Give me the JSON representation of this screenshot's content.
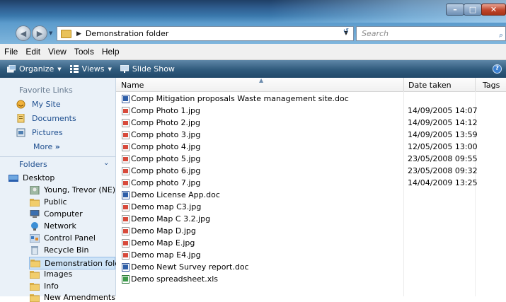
{
  "address": {
    "path": "Demonstration folder"
  },
  "search": {
    "placeholder": "Search"
  },
  "menu": [
    "File",
    "Edit",
    "View",
    "Tools",
    "Help"
  ],
  "toolbar": {
    "organize": "Organize",
    "views": "Views",
    "slideshow": "Slide Show"
  },
  "sidebar": {
    "favorites_title": "Favorite Links",
    "favorites": [
      "My Site",
      "Documents",
      "Pictures"
    ],
    "more": "More",
    "folders_title": "Folders",
    "tree": [
      "Desktop",
      "Young, Trevor (NE)",
      "Public",
      "Computer",
      "Network",
      "Control Panel",
      "Recycle Bin",
      "Demonstration fold",
      "Images",
      "Info",
      "New Amendments"
    ]
  },
  "columns": {
    "name": "Name",
    "date": "Date taken",
    "tags": "Tags"
  },
  "files": [
    {
      "name": "Comp Mitigation proposals Waste management site.doc",
      "date": "",
      "type": "doc"
    },
    {
      "name": "Comp Photo 1.jpg",
      "date": "14/09/2005 14:07",
      "type": "jpg"
    },
    {
      "name": "Comp Photo 2.jpg",
      "date": "14/09/2005 14:12",
      "type": "jpg"
    },
    {
      "name": "Comp photo 3.jpg",
      "date": "14/09/2005 13:59",
      "type": "jpg"
    },
    {
      "name": "Comp photo 4.jpg",
      "date": "12/05/2005 13:00",
      "type": "jpg"
    },
    {
      "name": "Comp photo 5.jpg",
      "date": "23/05/2008 09:55",
      "type": "jpg"
    },
    {
      "name": "Comp photo 6.jpg",
      "date": "23/05/2008 09:32",
      "type": "jpg"
    },
    {
      "name": "Comp photo 7.jpg",
      "date": "14/04/2009 13:25",
      "type": "jpg"
    },
    {
      "name": "Demo License App.doc",
      "date": "",
      "type": "doc"
    },
    {
      "name": "Demo map C3.jpg",
      "date": "",
      "type": "jpg"
    },
    {
      "name": "Demo Map C 3.2.jpg",
      "date": "",
      "type": "jpg"
    },
    {
      "name": "Demo Map D.jpg",
      "date": "",
      "type": "jpg"
    },
    {
      "name": "Demo Map E.jpg",
      "date": "",
      "type": "jpg"
    },
    {
      "name": "Demo map E4.jpg",
      "date": "",
      "type": "jpg"
    },
    {
      "name": "Demo Newt Survey report.doc",
      "date": "",
      "type": "doc"
    },
    {
      "name": "Demo spreadsheet.xls",
      "date": "",
      "type": "xls"
    }
  ]
}
